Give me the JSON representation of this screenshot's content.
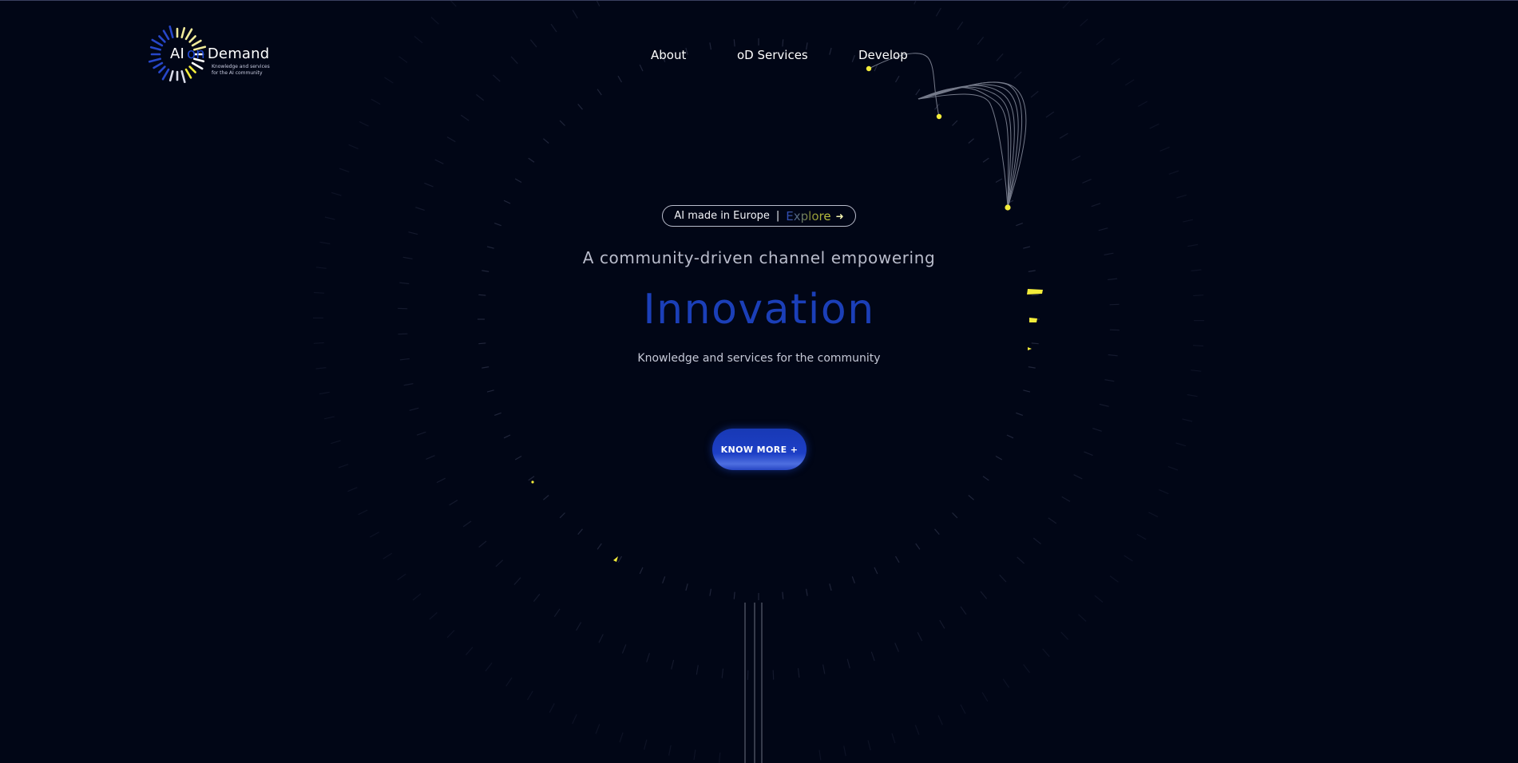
{
  "brand": {
    "logo_ai": "AI",
    "logo_on": "on",
    "logo_demand": "Demand",
    "logo_tagline": "Knowledge and services for the AI community"
  },
  "nav": {
    "items": [
      {
        "label": "About"
      },
      {
        "label": "oD Services"
      },
      {
        "label": "Develop"
      }
    ]
  },
  "hero": {
    "pill_text": "AI made in Europe",
    "pill_separator": "|",
    "explore_label": "Explore",
    "subtitle": "A community-driven channel empowering",
    "headline": "Innovation",
    "tagline": "Knowledge and services for the community",
    "cta_label": "KNOW MORE +"
  },
  "icons": {
    "explore_arrow": "arrow-right-icon",
    "logo": "sunburst-logo-icon"
  },
  "colors": {
    "background": "#010616",
    "accent_blue": "#1f48d6",
    "accent_yellow": "#f3ec3a",
    "tick_gray": "#2a2f45"
  }
}
